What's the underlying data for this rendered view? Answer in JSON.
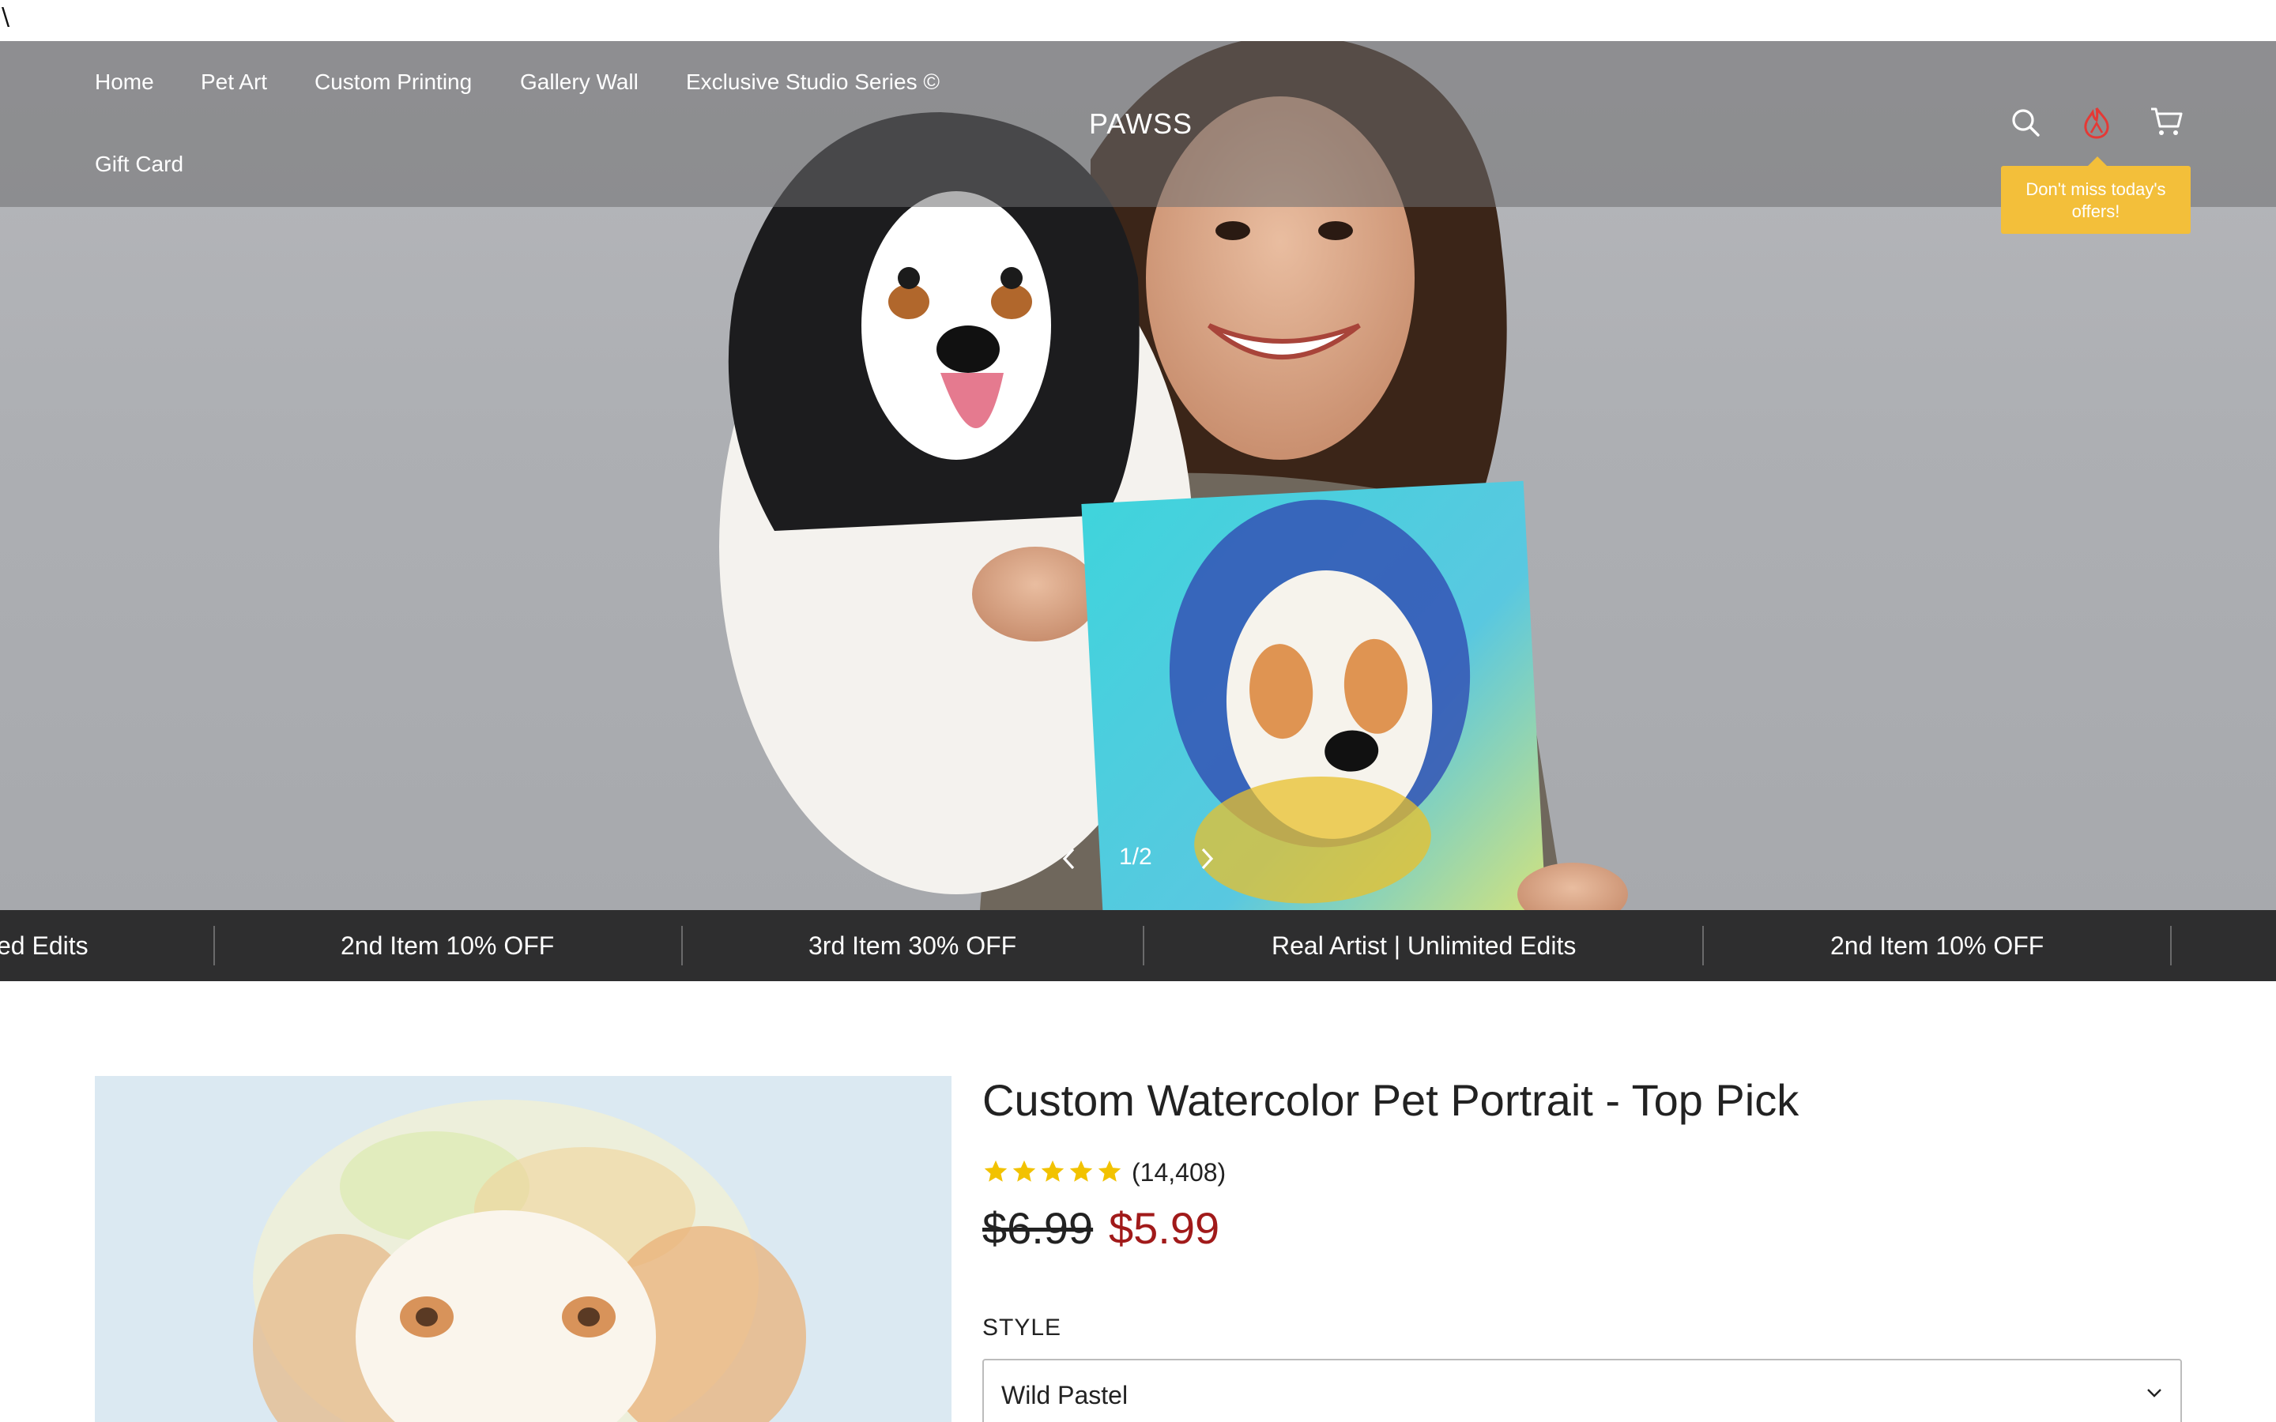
{
  "stray_char": "\\",
  "header": {
    "logo": "PAWSS",
    "nav": [
      "Home",
      "Pet Art",
      "Custom Printing",
      "Gallery Wall",
      "Exclusive Studio Series ©",
      "Gift Card"
    ],
    "icons": {
      "search": "search-icon",
      "offers": "flame-icon",
      "cart": "cart-icon"
    },
    "offer_tooltip": "Don't miss today's offers!"
  },
  "hero": {
    "counter": "1/2",
    "prev_icon": "chevron-left-icon",
    "next_icon": "chevron-right-icon"
  },
  "marquee": {
    "items": [
      "ed Edits",
      "2nd Item 10% OFF",
      "3rd Item 30% OFF",
      "Real Artist | Unlimited Edits",
      "2nd Item 10% OFF"
    ]
  },
  "product": {
    "title": "Custom Watercolor Pet Portrait - Top Pick",
    "rating_stars": 5,
    "reviews": "(14,408)",
    "price_old": "$6.99",
    "price_new": "$5.99",
    "style_label": "STYLE",
    "style_value": "Wild Pastel"
  },
  "colors": {
    "marquee_bg": "#2e2e2f",
    "tooltip_bg": "#f3bf3a",
    "sale_price": "#a11a1a",
    "offers_icon": "#e53935",
    "star": "#f2c200"
  }
}
